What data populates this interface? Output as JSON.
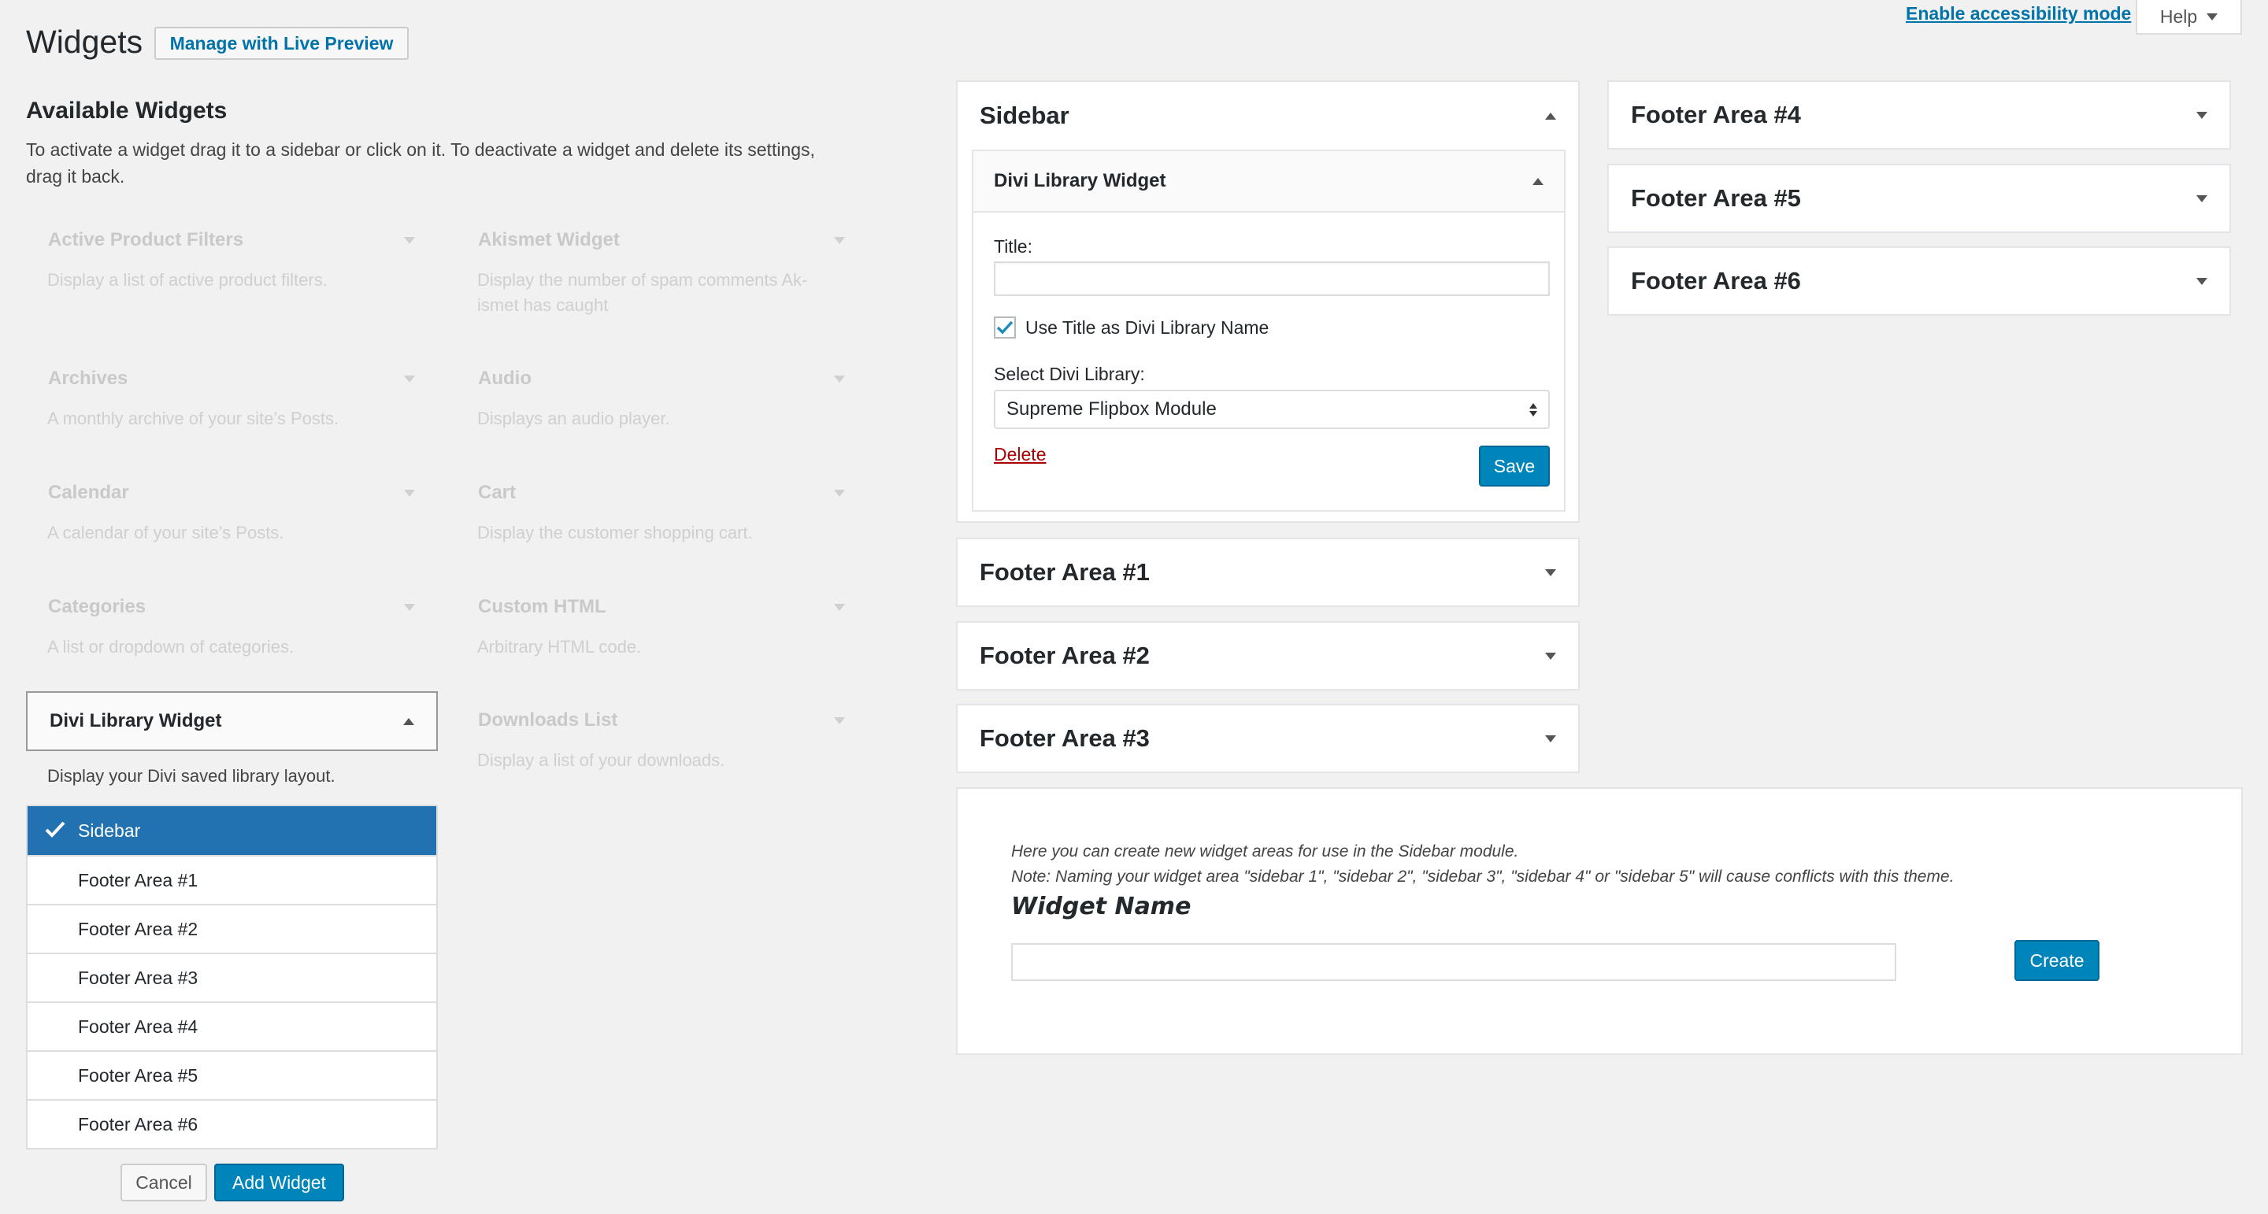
{
  "header": {
    "title": "Widgets",
    "live_preview_label": "Manage with Live Preview",
    "accessibility_link": "Enable accessibility mode",
    "help_label": "Help"
  },
  "available": {
    "title": "Available Widgets",
    "description": "To activate a widget drag it to a sidebar or click on it. To deactivate a widget and delete its settings, drag it back.",
    "widgets": [
      {
        "title": "Active Product Filters",
        "desc": "Display a list of active product filters."
      },
      {
        "title": "Akismet Widget",
        "desc": "Display the number of spam comments Ak-ismet has caught"
      },
      {
        "title": "Archives",
        "desc": "A monthly archive of your site’s Posts."
      },
      {
        "title": "Audio",
        "desc": "Displays an audio player."
      },
      {
        "title": "Calendar",
        "desc": "A calendar of your site’s Posts."
      },
      {
        "title": "Cart",
        "desc": "Display the customer shopping cart."
      },
      {
        "title": "Categories",
        "desc": "A list or dropdown of categories."
      },
      {
        "title": "Custom HTML",
        "desc": "Arbitrary HTML code."
      },
      {
        "title": "Downloads List",
        "desc": "Display a list of your downloads."
      }
    ],
    "selected_widget": {
      "title": "Divi Library Widget",
      "desc": "Display your Divi saved library layout."
    },
    "chooser_options": [
      "Sidebar",
      "Footer Area #1",
      "Footer Area #2",
      "Footer Area #3",
      "Footer Area #4",
      "Footer Area #5",
      "Footer Area #6"
    ],
    "cancel_label": "Cancel",
    "add_widget_label": "Add Widget"
  },
  "sidebar": {
    "title": "Sidebar",
    "widget": {
      "title": "Divi Library Widget",
      "title_label": "Title:",
      "title_value": "",
      "use_title_label": "Use Title as Divi Library Name",
      "use_title_checked": true,
      "select_label": "Select Divi Library:",
      "select_value": "Supreme Flipbox Module",
      "delete_label": "Delete",
      "save_label": "Save"
    }
  },
  "areas_left": [
    "Footer Area #1",
    "Footer Area #2",
    "Footer Area #3"
  ],
  "areas_right": [
    "Footer Area #4",
    "Footer Area #5",
    "Footer Area #6"
  ],
  "create_area": {
    "line1": "Here you can create new widget areas for use in the Sidebar module.",
    "line2": "Note: Naming your widget area \"sidebar 1\", \"sidebar 2\", \"sidebar 3\", \"sidebar 4\" or \"sidebar 5\" will cause conflicts with this theme.",
    "name_label": "Widget Name",
    "name_value": "",
    "create_label": "Create"
  },
  "colors": {
    "accent": "#0085ba",
    "link": "#0073aa",
    "delete": "#aa0000",
    "selected": "#2271b1"
  }
}
